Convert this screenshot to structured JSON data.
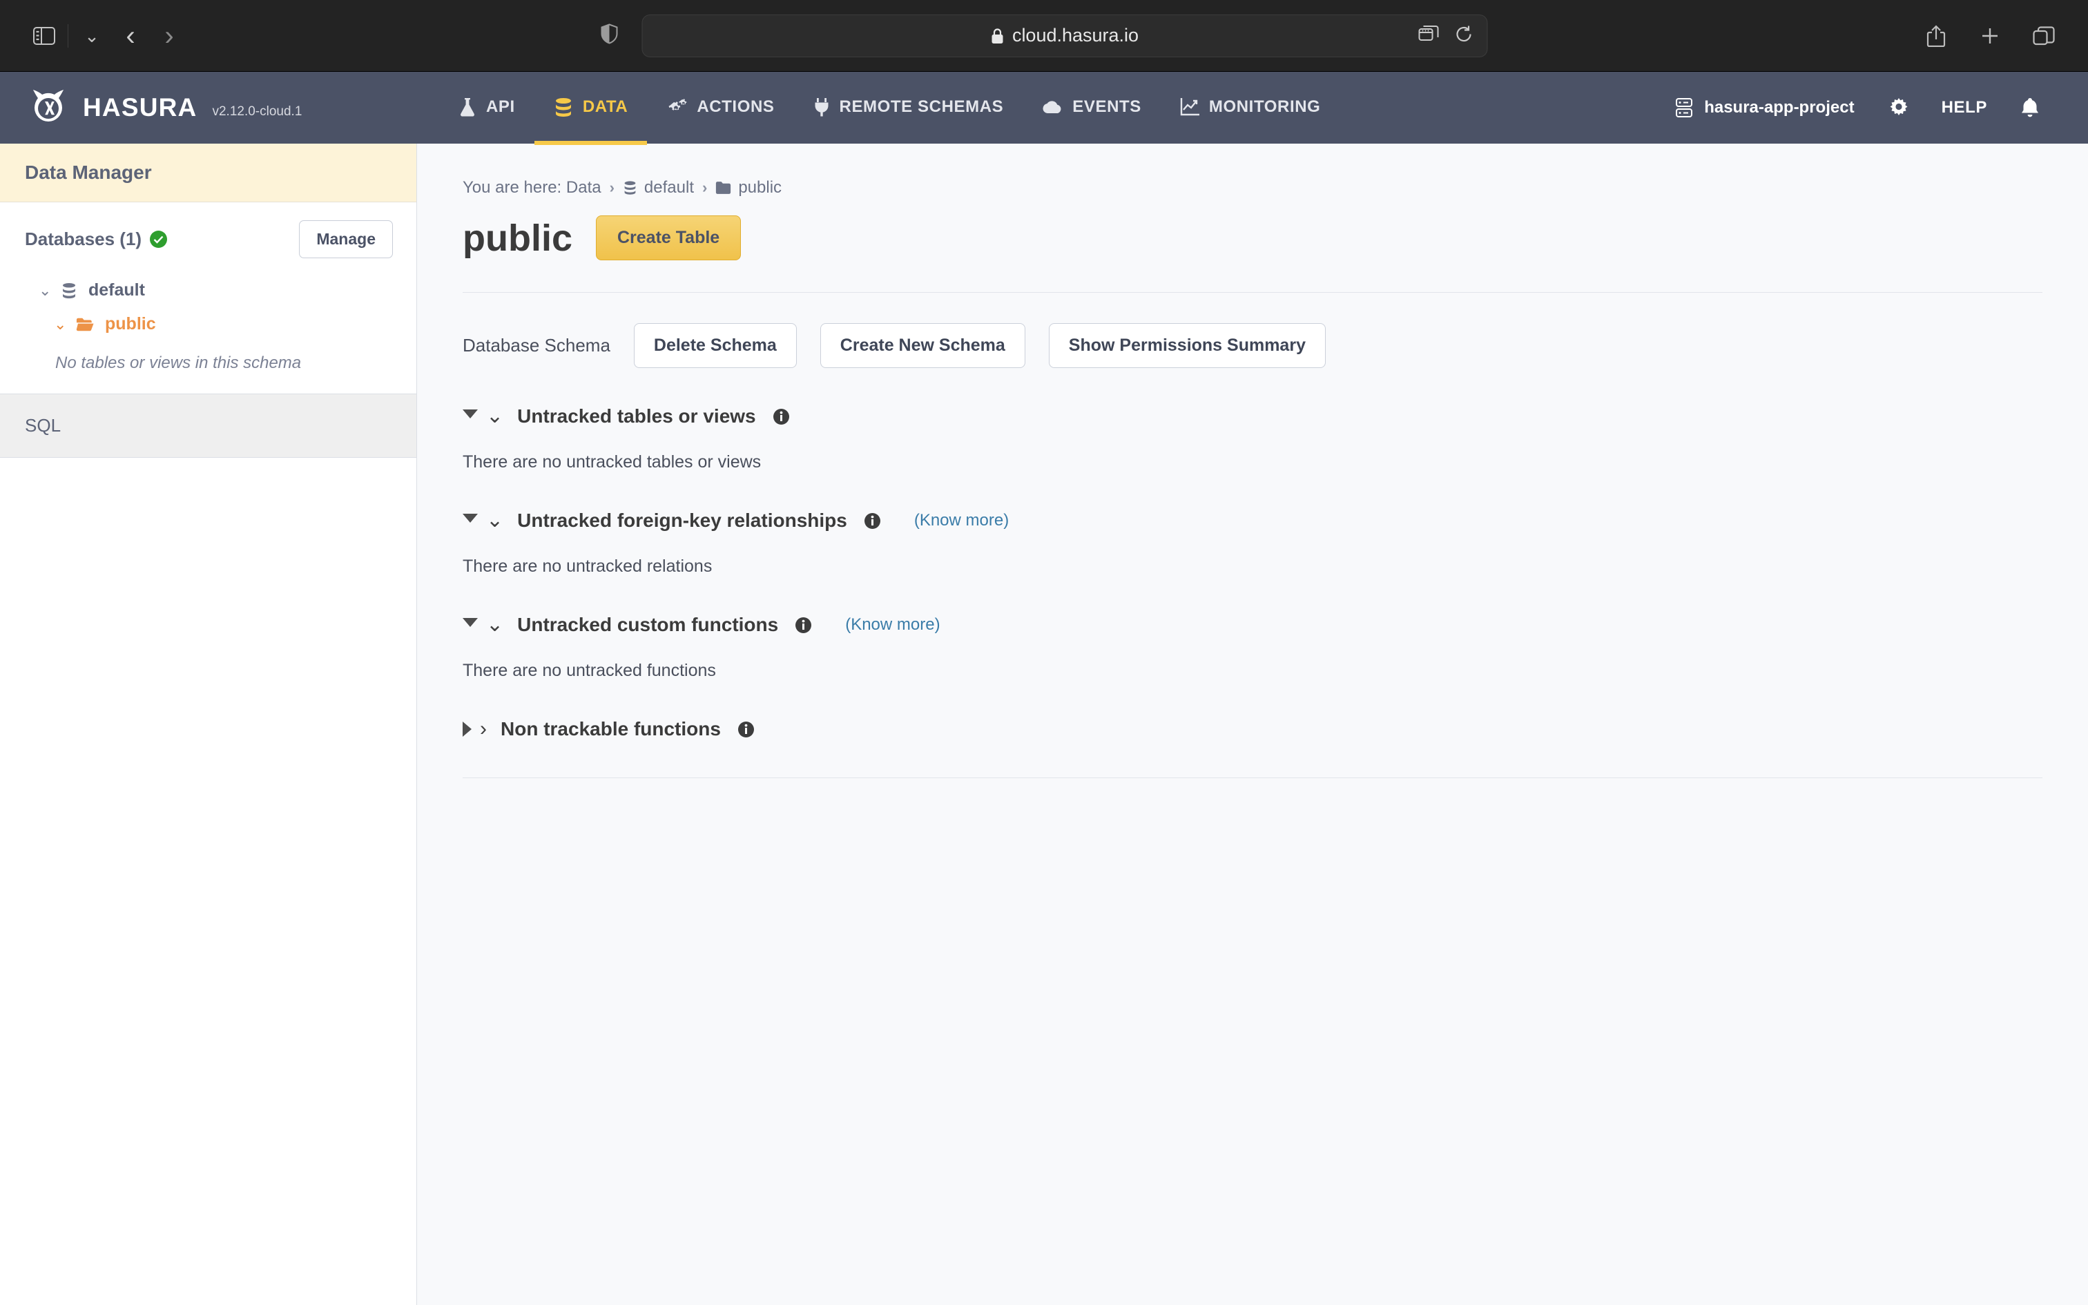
{
  "browser": {
    "url": "cloud.hasura.io",
    "lock_icon": "lock-icon",
    "sidebar_toggle_icon": "sidebar-toggle-icon",
    "tab_overview_icon": "tab-overview-icon",
    "back_icon": "chevron-left-icon",
    "forward_icon": "chevron-right-icon",
    "shield_icon": "privacy-shield-icon",
    "reader_icon": "tab-group-icon",
    "reload_icon": "reload-icon",
    "share_icon": "share-icon",
    "new_tab_icon": "plus-icon",
    "tabs_icon": "tabs-icon"
  },
  "app_header": {
    "brand": "HASURA",
    "version": "v2.12.0-cloud.1",
    "nav": [
      {
        "label": "API",
        "icon": "flask-icon",
        "active": false
      },
      {
        "label": "DATA",
        "icon": "database-icon",
        "active": true
      },
      {
        "label": "ACTIONS",
        "icon": "gears-icon",
        "active": false
      },
      {
        "label": "REMOTE SCHEMAS",
        "icon": "plug-icon",
        "active": false
      },
      {
        "label": "EVENTS",
        "icon": "cloud-icon",
        "active": false
      },
      {
        "label": "MONITORING",
        "icon": "chart-line-icon",
        "active": false
      }
    ],
    "project_name": "hasura-app-project",
    "project_icon": "server-icon",
    "settings_icon": "gear-icon",
    "help_label": "HELP",
    "bell_icon": "bell-icon",
    "accent_color": "#f7c948",
    "background_color": "#4b5266"
  },
  "sidebar": {
    "title": "Data Manager",
    "databases_label": "Databases (1)",
    "status_icon": "check-circle-icon",
    "manage_label": "Manage",
    "tree": [
      {
        "label": "default",
        "icon": "database-icon",
        "chevron": "chevron-down-icon",
        "active": false
      },
      {
        "label": "public",
        "icon": "folder-open-icon",
        "chevron": "chevron-down-icon",
        "active": true
      }
    ],
    "empty_schema_note": "No tables or views in this schema",
    "sql_label": "SQL",
    "title_bg": "#fdf3d8",
    "active_color": "#ed9347"
  },
  "main": {
    "breadcrumb": {
      "prefix": "You are here: Data",
      "database": "default",
      "schema": "public",
      "separator": "›",
      "database_icon": "database-icon",
      "schema_icon": "folder-icon"
    },
    "page_title": "public",
    "create_table_label": "Create Table",
    "schema_toolbar": {
      "label": "Database Schema",
      "buttons": [
        "Delete Schema",
        "Create New Schema",
        "Show Permissions Summary"
      ]
    },
    "sections": [
      {
        "title": "Untracked tables or views",
        "expanded": true,
        "info_icon": "info-circle-icon",
        "know_more": "",
        "body": "There are no untracked tables or views"
      },
      {
        "title": "Untracked foreign-key relationships",
        "expanded": true,
        "info_icon": "info-circle-icon",
        "know_more": "(Know more)",
        "body": "There are no untracked relations"
      },
      {
        "title": "Untracked custom functions",
        "expanded": true,
        "info_icon": "info-circle-icon",
        "know_more": "(Know more)",
        "body": "There are no untracked functions"
      },
      {
        "title": "Non trackable functions",
        "expanded": false,
        "info_icon": "info-circle-icon",
        "know_more": "",
        "body": ""
      }
    ]
  }
}
